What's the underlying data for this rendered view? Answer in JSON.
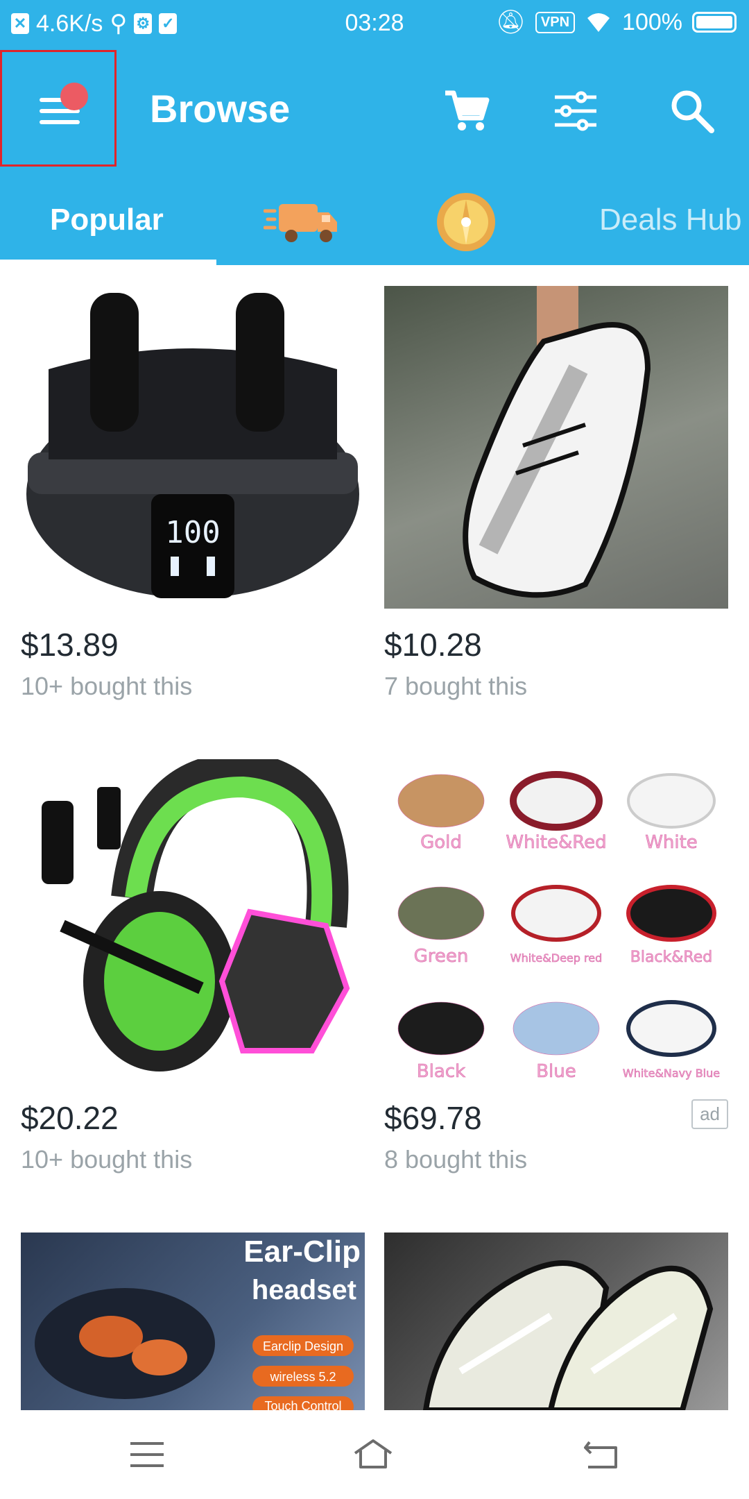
{
  "status_bar": {
    "network_speed": "4.6K/s",
    "time": "03:28",
    "vpn_label": "VPN",
    "battery": "100%"
  },
  "header": {
    "title": "Browse",
    "has_notification": true
  },
  "tabs": {
    "popular": "Popular",
    "deals": "Deals Hub"
  },
  "products": [
    {
      "price": "$13.89",
      "bought": "10+ bought this",
      "image": "earbuds-image"
    },
    {
      "price": "$10.28",
      "bought": "7 bought this",
      "image": "shoe-image"
    },
    {
      "price": "$20.22",
      "bought": "10+ bought this",
      "image": "headset-image"
    },
    {
      "price": "$69.78",
      "bought": "8 bought this",
      "image": "sneakers-grid-image",
      "ad_label": "ad",
      "image_text": [
        "Gold",
        "White&Red",
        "White",
        "Green",
        "White&Deep red",
        "Black&Red",
        "Black",
        "Blue",
        "White&Navy Blue"
      ]
    },
    {
      "image": "earclip-headset-image",
      "image_text": [
        "Ear-Clip",
        "headset",
        "Earclip Design",
        "wireless 5.2",
        "Touch Control"
      ]
    },
    {
      "image": "loafer-shoe-image"
    }
  ],
  "colors": {
    "brand": "#2fb3e8",
    "price": "#222b33",
    "muted": "#9aa3a8",
    "badge": "#ec5b63"
  }
}
